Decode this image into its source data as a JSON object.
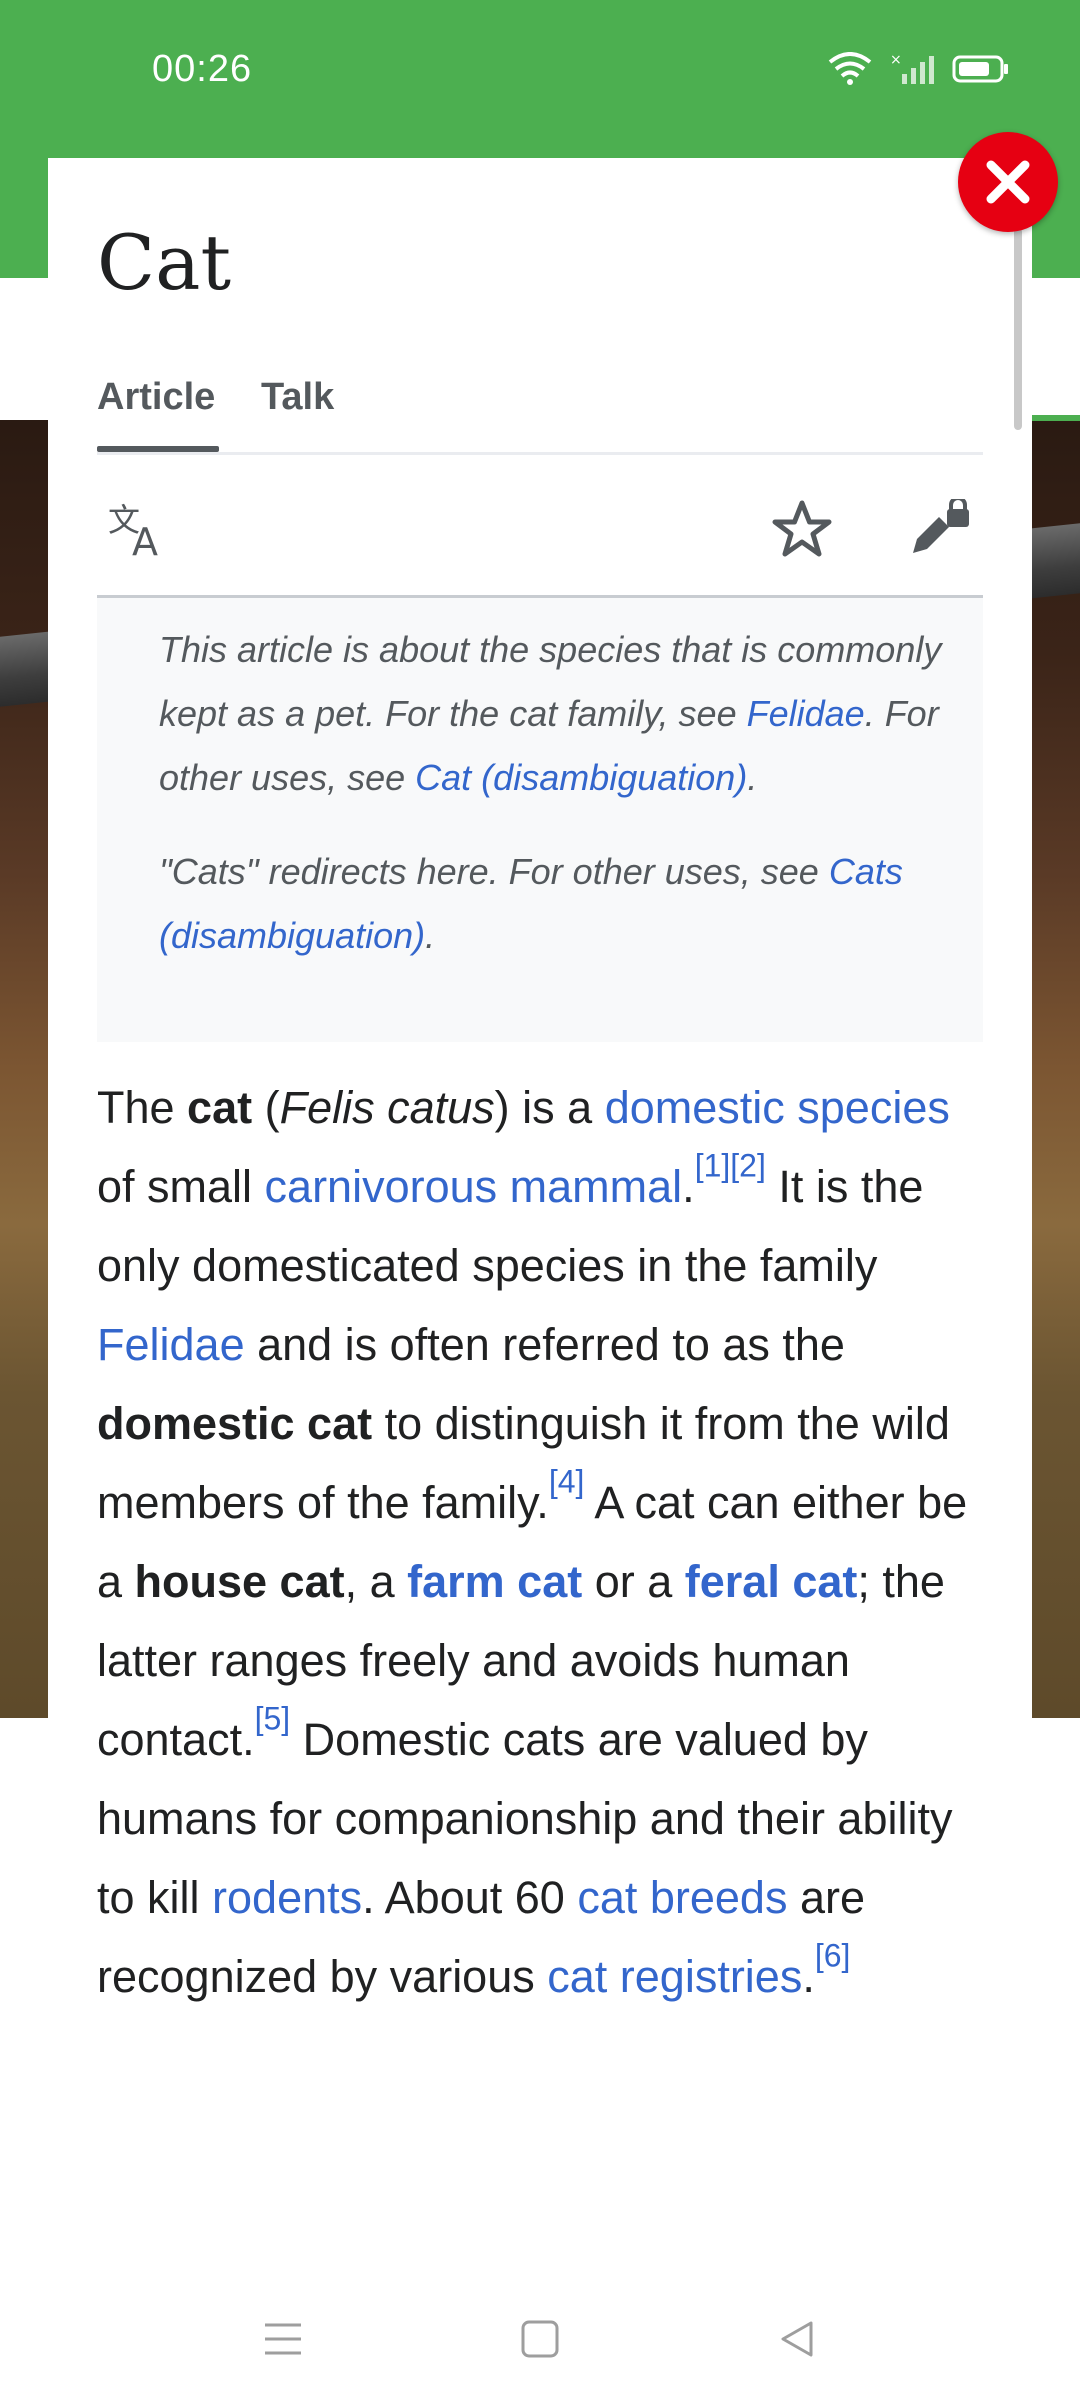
{
  "status_bar": {
    "time": "00:26"
  },
  "dialog": {
    "title": "Cat",
    "tabs": [
      {
        "label": "Article",
        "active": true
      },
      {
        "label": "Talk",
        "active": false
      }
    ],
    "toolbar_icons": [
      "translate-icon",
      "star-icon",
      "edit-lock-icon"
    ],
    "hatnote": {
      "p1": {
        "t1": "This article is about the species that is commonly kept as a pet. For the cat family, see ",
        "l1": "Felidae",
        "t2": ". For other uses, see ",
        "l2": "Cat (disambiguation)",
        "t3": "."
      },
      "p2": {
        "t1": "\"Cats\" redirects here. For other uses, see ",
        "l1": "Cats (disambiguation)",
        "t2": "."
      }
    },
    "article": {
      "s1": "The ",
      "b1": "cat",
      "s2": " (",
      "i1": "Felis catus",
      "s3": ") is a ",
      "l1": "domestic species",
      "s4": " of small ",
      "l2": "carnivorous mammal",
      "s5": ".",
      "ref1": "[1]",
      "ref2": "[2]",
      "s6": " It is the only domesticated species in the family ",
      "l3": "Felidae",
      "s7": " and is often referred to as the ",
      "b2": "domestic cat",
      "s8": " to distinguish it from the wild members of the family.",
      "ref4": "[4]",
      "s9": " A cat can either be a ",
      "b3": "house cat",
      "s10": ", a ",
      "l4": "farm cat",
      "s11": " or a ",
      "l5": "feral cat",
      "s12": "; the latter ranges freely and avoids human contact.",
      "ref5": "[5]",
      "s13": " Domestic cats are valued by humans for companionship and their ability to kill ",
      "l6": "rodents",
      "s14": ". About 60 ",
      "l7": "cat breeds",
      "s15": " are recognized by various ",
      "l8": "cat registries",
      "s16": ".",
      "ref6": "[6]"
    }
  },
  "colors": {
    "header_green": "#4caf50",
    "close_red": "#e60012",
    "link_blue": "#3366cc",
    "text": "#202122"
  }
}
